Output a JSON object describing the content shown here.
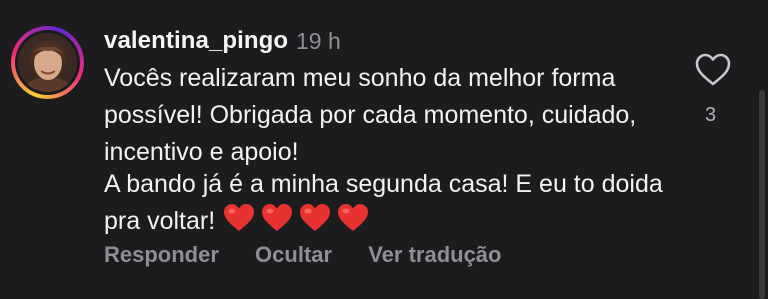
{
  "comment": {
    "username": "valentina_pingo",
    "time": "19 h",
    "paragraph1": "Vocês realizaram meu sonho da melhor forma possível! Obrigada por cada momento, cuidado, incentivo e apoio!",
    "paragraph2": "A bando já é a minha segunda casa! E eu to doida pra voltar!",
    "like_count": "3",
    "heart_color": "#e8322f"
  },
  "actions": {
    "reply": "Responder",
    "hide": "Ocultar",
    "translate": "Ver tradução"
  }
}
